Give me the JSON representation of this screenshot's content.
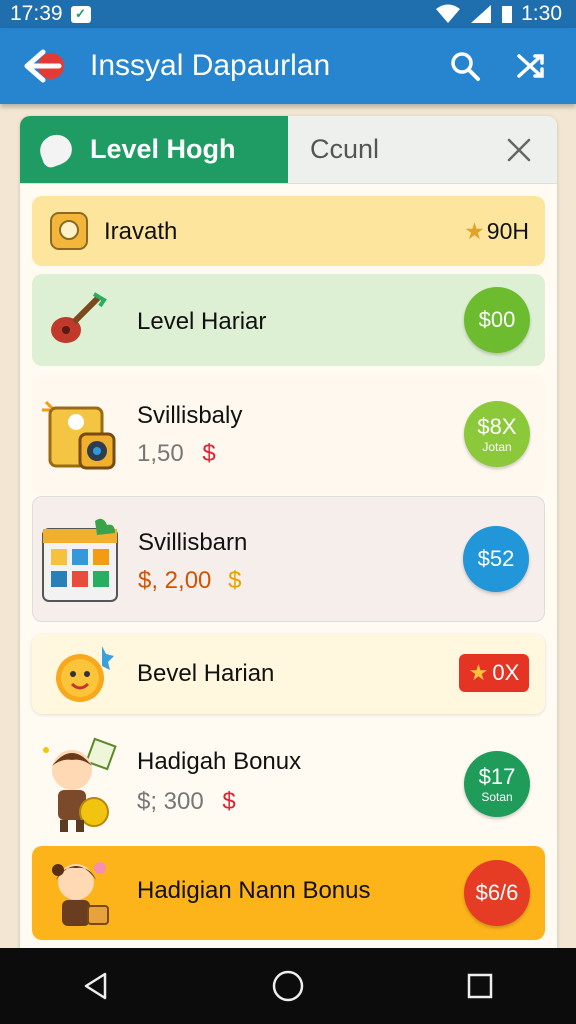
{
  "status": {
    "time": "17:39",
    "clock": "1:30"
  },
  "appbar": {
    "title": "Inssyal Dapaurlan"
  },
  "tabs": {
    "active": "Level Hogh",
    "inactive": "Ccunl"
  },
  "items": [
    {
      "title": "Iravath",
      "badge": "90H",
      "bg": "#fde59e",
      "icon": "trophy-icon"
    },
    {
      "title": "Level Hariar",
      "badge": "$00",
      "bg": "#ddf0d3",
      "icon": "guitar-icon"
    },
    {
      "title": "Svillisbaly",
      "sub": "1,50",
      "sub_sym": "$",
      "badge": "$8X",
      "badge_sub": "Jotan",
      "bg": "#fff8ee",
      "icon": "speaker-box-icon"
    },
    {
      "title": "Svillisbarn",
      "sub": "$, 2,00",
      "sub_sym": "$",
      "badge": "$52",
      "bg": "#f6eeea",
      "icon": "calendar-grid-icon"
    },
    {
      "title": "Bevel Harian",
      "badge": "0X",
      "bg": "#fff8df",
      "icon": "sun-face-icon"
    },
    {
      "title": "Hadigah Bonux",
      "sub": "$; 300",
      "sub_sym": "$",
      "badge": "$17",
      "badge_sub": "Sotan",
      "bg": "#fffaf2",
      "icon": "character-icon"
    },
    {
      "title": "Hadigian Nann Bonus",
      "badge": "$6/6",
      "bg": "#fdb31a",
      "icon": "girl-character-icon"
    }
  ],
  "colors": {
    "appbar": "#2784cf",
    "tab_active": "#1f9c63",
    "badge_green": "#6dbb2f",
    "badge_blue": "#2196d8",
    "badge_red": "#e63b24"
  }
}
